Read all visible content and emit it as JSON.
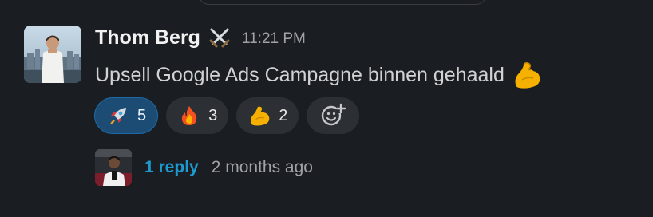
{
  "message": {
    "author": "Thom Berg",
    "status_icon": "crossed-swords-icon",
    "timestamp": "11:21 PM",
    "text": "Upsell Google Ads Campagne binnen gehaald",
    "text_emoji": "flexed-biceps-icon"
  },
  "reactions": [
    {
      "emoji": "rocket-icon",
      "count": "5",
      "active": true
    },
    {
      "emoji": "fire-icon",
      "count": "3",
      "active": false
    },
    {
      "emoji": "flexed-biceps-icon",
      "count": "2",
      "active": false
    }
  ],
  "add_reaction_icon": "add-reaction-icon",
  "thread": {
    "reply_label": "1 reply",
    "last_reply": "2 months ago"
  },
  "colors": {
    "background": "#1a1d21",
    "link": "#1d9bd1",
    "active_reaction": "#1c4b74",
    "reaction_bg": "#2c2f33"
  }
}
